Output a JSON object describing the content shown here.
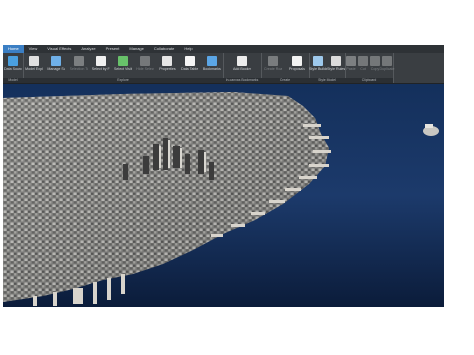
{
  "menubar": {
    "items": [
      {
        "label": "Home",
        "active": true
      },
      {
        "label": "View"
      },
      {
        "label": "Visual Effects"
      },
      {
        "label": "Analyze"
      },
      {
        "label": "Present"
      },
      {
        "label": "Manage"
      },
      {
        "label": "Collaborate"
      },
      {
        "label": "Help"
      }
    ]
  },
  "ribbon": {
    "groups": [
      {
        "id": "model",
        "label": "Model",
        "buttons": [
          {
            "label": "Data Sources",
            "icon": "database-icon"
          }
        ]
      },
      {
        "id": "explore",
        "label": "Explore",
        "buttons": [
          {
            "label": "Model Explorer",
            "icon": "tree-icon"
          },
          {
            "label": "Manage Surface Layers",
            "icon": "layers-icon"
          },
          {
            "label": "Selection Tool",
            "icon": "cursor-icon",
            "dim": true
          },
          {
            "label": "Select by Filter",
            "icon": "filter-icon"
          },
          {
            "label": "Select Visible",
            "icon": "select-visible-icon"
          },
          {
            "label": "Hide Selection",
            "icon": "hide-icon",
            "dim": true
          },
          {
            "label": "Properties",
            "icon": "properties-icon"
          },
          {
            "label": "Data Table",
            "icon": "table-icon"
          },
          {
            "label": "Bookmarks",
            "icon": "bookmark-icon"
          }
        ]
      },
      {
        "id": "bookmarks",
        "label": "In-canvas Bookmarks",
        "buttons": [
          {
            "label": "Add Bookmark",
            "icon": "add-bookmark-icon"
          }
        ]
      },
      {
        "id": "create",
        "label": "Create",
        "buttons": [
          {
            "label": "Create Road",
            "icon": "road-icon",
            "dim": true
          },
          {
            "label": "Proposals",
            "icon": "proposals-icon"
          }
        ]
      },
      {
        "id": "styles",
        "label": "Style Model",
        "buttons": [
          {
            "label": "Style Builder",
            "icon": "style-icon"
          },
          {
            "label": "Style Rules",
            "icon": "rules-icon"
          }
        ]
      },
      {
        "id": "clipboard",
        "label": "Clipboard",
        "buttons": [
          {
            "label": "Paste",
            "icon": "paste-icon",
            "dim": true
          },
          {
            "label": "Cut",
            "icon": "cut-icon",
            "dim": true
          },
          {
            "label": "Copy",
            "icon": "copy-icon",
            "dim": true
          },
          {
            "label": "Duplicate",
            "icon": "duplicate-icon",
            "dim": true
          }
        ]
      }
    ]
  },
  "scene": {
    "description_colors": {
      "water": "#1c3a6b",
      "water_dark": "#0a1a36",
      "city": "#8c8c8c",
      "pier": "#d8d4cc"
    }
  }
}
